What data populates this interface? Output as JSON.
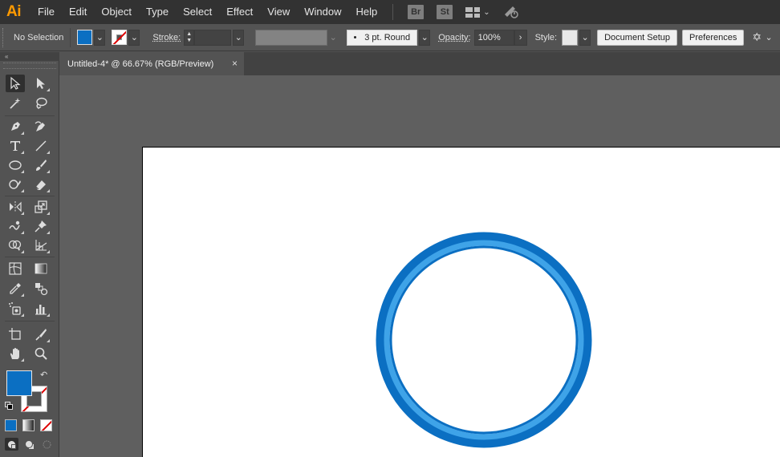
{
  "app": {
    "logo": "Ai"
  },
  "menu": [
    "File",
    "Edit",
    "Object",
    "Type",
    "Select",
    "Effect",
    "View",
    "Window",
    "Help"
  ],
  "menubar_apps": {
    "bridge": "Br",
    "stock": "St"
  },
  "control": {
    "selection": "No Selection",
    "stroke_label": "Stroke:",
    "stroke_weight": "",
    "brush": "3 pt. Round",
    "opacity_label": "Opacity:",
    "opacity": "100%",
    "style_label": "Style:",
    "document_setup": "Document Setup",
    "preferences": "Preferences"
  },
  "tab": {
    "title": "Untitled-4* @ 66.67% (RGB/Preview)",
    "close": "×"
  },
  "colors": {
    "fill": "#0b6fc2",
    "ring_outer": "#0b6fc2",
    "ring_inner": "#3ea3e8",
    "accent_logo": "#ff9a00"
  }
}
